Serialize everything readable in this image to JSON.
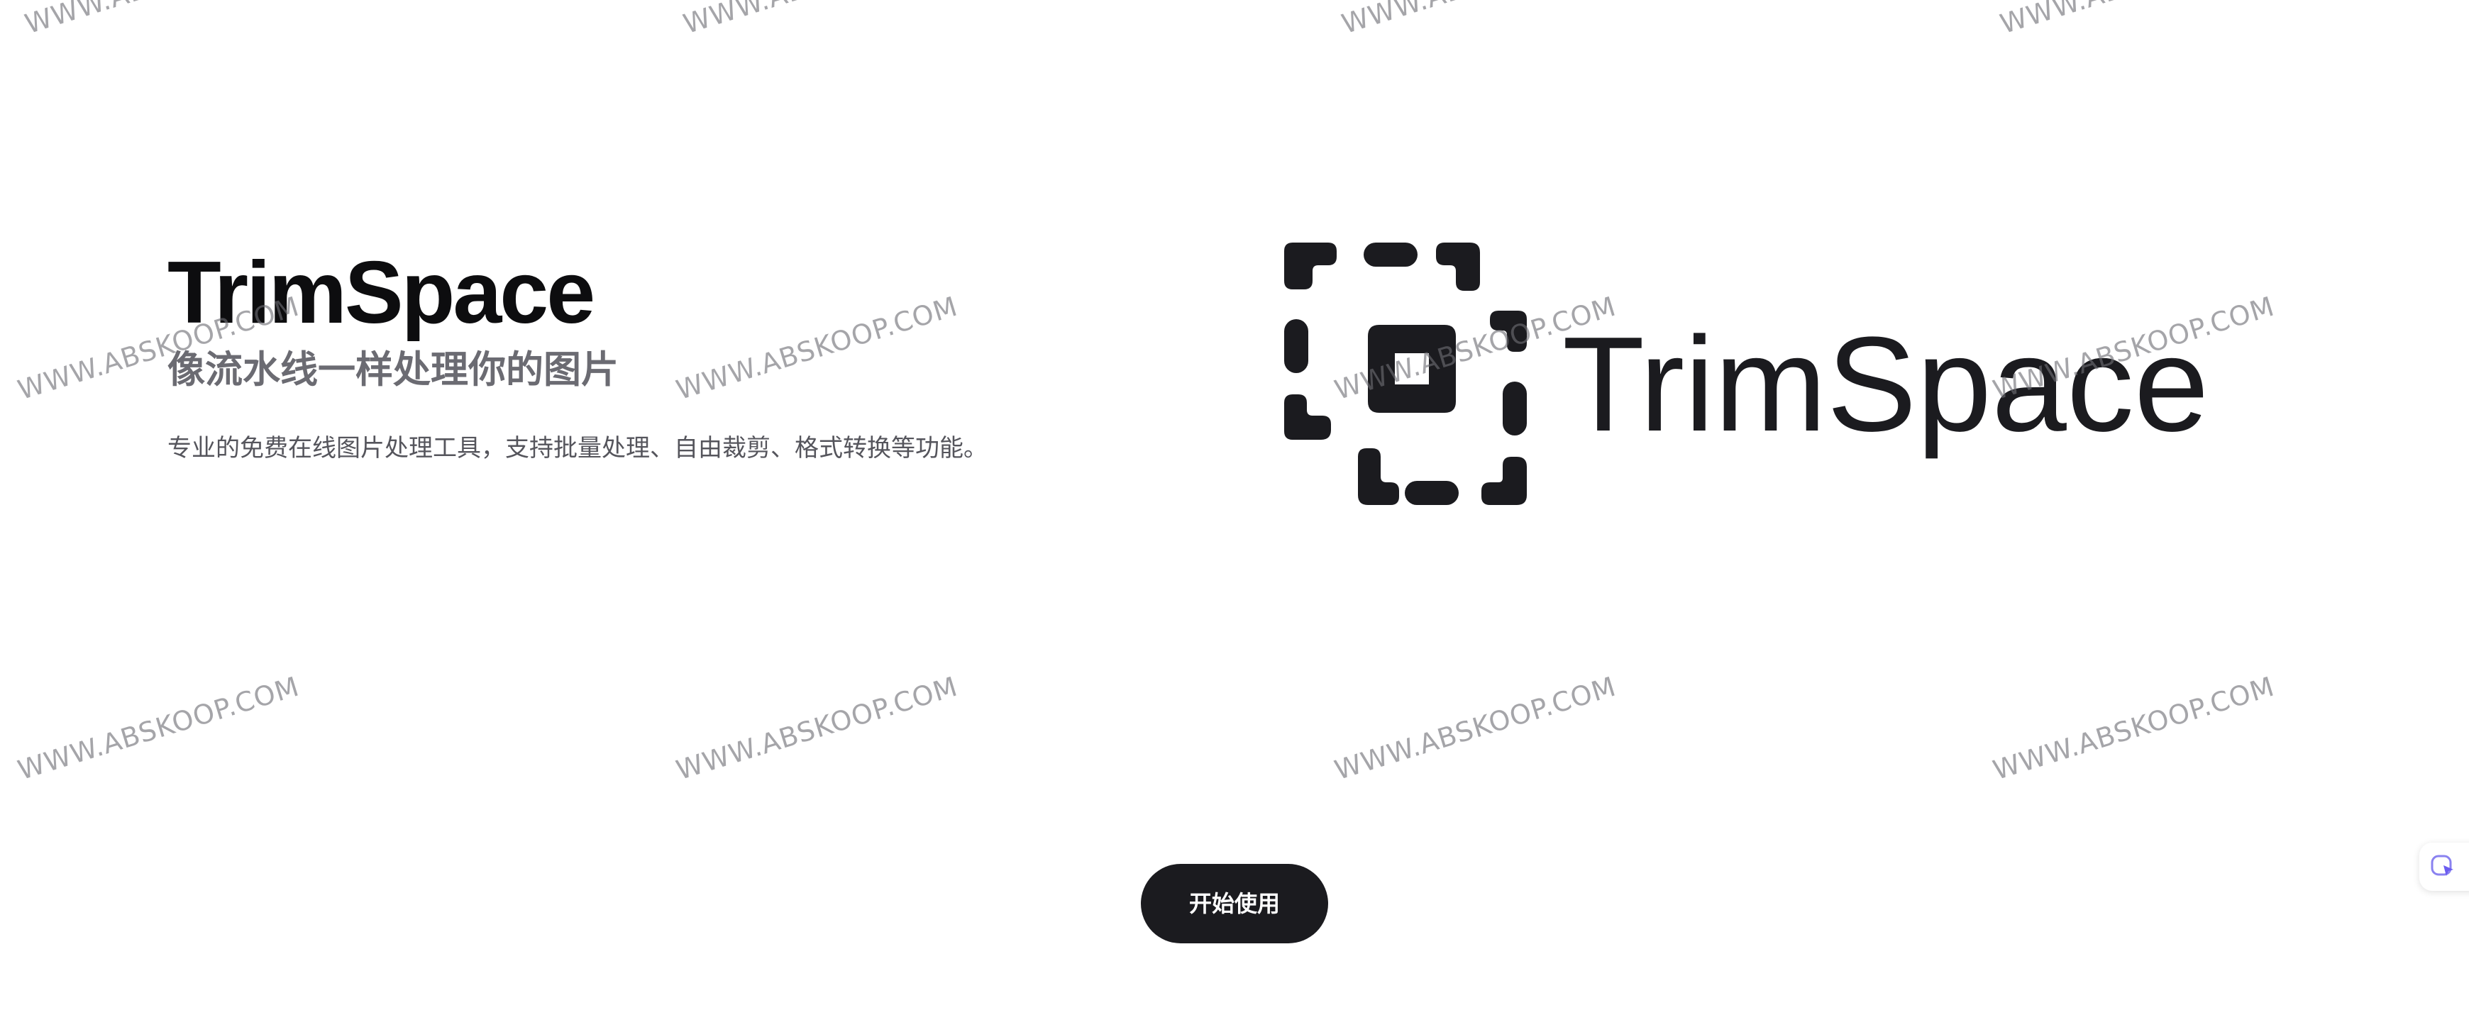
{
  "hero": {
    "title": "TrimSpace",
    "subtitle": "像流水线一样处理你的图片",
    "description": "专业的免费在线图片处理工具，支持批量处理、自由裁剪、格式转换等功能。"
  },
  "logo": {
    "wordmark": "TrimSpace",
    "color": "#1b1b1f"
  },
  "cta": {
    "label": "开始使用"
  },
  "watermark": {
    "text": "WWW.ABSKOOP.COM"
  },
  "colors": {
    "title": "#0d0d0f",
    "subtitle": "#6b6b72",
    "button_bg": "#1b1b1f",
    "button_text": "#ffffff",
    "widget_accent": "#7b6cf6"
  }
}
